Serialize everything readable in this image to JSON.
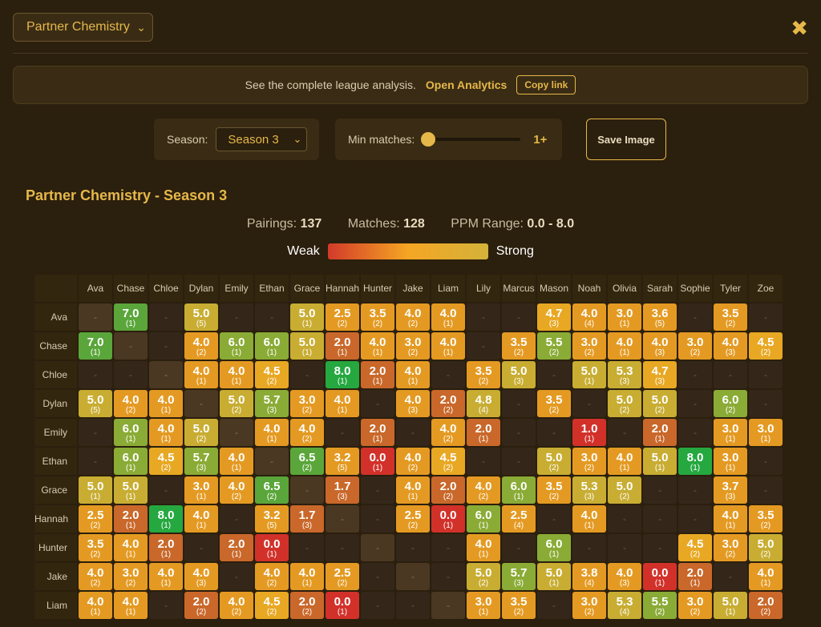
{
  "header": {
    "mode_label": "Partner Chemistry",
    "close_glyph": "✖"
  },
  "banner": {
    "text": "See the complete league analysis.",
    "link": "Open Analytics",
    "copy": "Copy link"
  },
  "controls": {
    "season_label": "Season:",
    "season_value": "Season 3",
    "min_label": "Min matches:",
    "min_value": "1+",
    "min_level_fraction": 0,
    "save_label": "Save Image"
  },
  "title": "Partner Chemistry - Season 3",
  "stats": {
    "pairings_label": "Pairings:",
    "pairings_value": "137",
    "matches_label": "Matches:",
    "matches_value": "128",
    "range_label": "PPM Range:",
    "range_value": "0.0 - 8.0"
  },
  "legend": {
    "weak": "Weak",
    "strong": "Strong"
  },
  "colors": {
    "accent": "#e6b84a",
    "background": "#2b1f0d",
    "panel": "#3a2c14"
  },
  "matrix": {
    "columns": [
      "Ava",
      "Chase",
      "Chloe",
      "Dylan",
      "Emily",
      "Ethan",
      "Grace",
      "Hannah",
      "Hunter",
      "Jake",
      "Liam",
      "Lily",
      "Marcus",
      "Mason",
      "Noah",
      "Olivia",
      "Sarah",
      "Sophie",
      "Tyler",
      "Zoe"
    ],
    "rows": [
      {
        "name": "Ava",
        "cells": [
          "-",
          "7.0|1",
          "-",
          "5.0|5",
          "-",
          "-",
          "5.0|1",
          "2.5|2",
          "3.5|2",
          "4.0|2",
          "4.0|1",
          "-",
          "-",
          "4.7|3",
          "4.0|4",
          "3.0|1",
          "3.6|5",
          "-",
          "3.5|2",
          "-"
        ]
      },
      {
        "name": "Chase",
        "cells": [
          "7.0|1",
          "-",
          "-",
          "4.0|2",
          "6.0|1",
          "6.0|1",
          "5.0|1",
          "2.0|1",
          "4.0|1",
          "3.0|2",
          "4.0|1",
          "-",
          "3.5|2",
          "5.5|2",
          "3.0|2",
          "4.0|1",
          "4.0|3",
          "3.0|2",
          "4.0|3",
          "4.5|2"
        ]
      },
      {
        "name": "Chloe",
        "cells": [
          "-",
          "-",
          "-",
          "4.0|1",
          "4.0|1",
          "4.5|2",
          "-",
          "8.0|1",
          "2.0|1",
          "4.0|1",
          "-",
          "3.5|2",
          "5.0|3",
          "-",
          "5.0|1",
          "5.3|3",
          "4.7|3",
          "-",
          "-",
          "-"
        ]
      },
      {
        "name": "Dylan",
        "cells": [
          "5.0|5",
          "4.0|2",
          "4.0|1",
          "-",
          "5.0|2",
          "5.7|3",
          "3.0|2",
          "4.0|1",
          "-",
          "4.0|3",
          "2.0|2",
          "4.8|4",
          "-",
          "3.5|2",
          "-",
          "5.0|2",
          "5.0|2",
          "-",
          "6.0|2",
          "-"
        ]
      },
      {
        "name": "Emily",
        "cells": [
          "-",
          "6.0|1",
          "4.0|1",
          "5.0|2",
          "-",
          "4.0|1",
          "4.0|2",
          "-",
          "2.0|1",
          "-",
          "4.0|2",
          "2.0|1",
          "-",
          "-",
          "1.0|1",
          "-",
          "2.0|1",
          "-",
          "3.0|1",
          "3.0|1"
        ]
      },
      {
        "name": "Ethan",
        "cells": [
          "-",
          "6.0|1",
          "4.5|2",
          "5.7|3",
          "4.0|1",
          "-",
          "6.5|2",
          "3.2|5",
          "0.0|1",
          "4.0|2",
          "4.5|2",
          "-",
          "-",
          "5.0|2",
          "3.0|2",
          "4.0|1",
          "5.0|1",
          "8.0|1",
          "3.0|1",
          "-"
        ]
      },
      {
        "name": "Grace",
        "cells": [
          "5.0|1",
          "5.0|1",
          "-",
          "3.0|1",
          "4.0|2",
          "6.5|2",
          "-",
          "1.7|3",
          "-",
          "4.0|1",
          "2.0|2",
          "4.0|2",
          "6.0|1",
          "3.5|2",
          "5.3|3",
          "5.0|2",
          "-",
          "-",
          "3.7|3",
          "-"
        ]
      },
      {
        "name": "Hannah",
        "cells": [
          "2.5|2",
          "2.0|1",
          "8.0|1",
          "4.0|1",
          "-",
          "3.2|5",
          "1.7|3",
          "-",
          "-",
          "2.5|2",
          "0.0|1",
          "6.0|1",
          "2.5|4",
          "-",
          "4.0|1",
          "-",
          "-",
          "-",
          "4.0|1",
          "3.5|2"
        ]
      },
      {
        "name": "Hunter",
        "cells": [
          "3.5|2",
          "4.0|1",
          "2.0|1",
          "-",
          "2.0|1",
          "0.0|1",
          "-",
          "-",
          "-",
          "-",
          "-",
          "4.0|1",
          "-",
          "6.0|1",
          "-",
          "-",
          "-",
          "4.5|2",
          "3.0|2",
          "5.0|2"
        ]
      },
      {
        "name": "Jake",
        "cells": [
          "4.0|2",
          "3.0|2",
          "4.0|1",
          "4.0|3",
          "-",
          "4.0|2",
          "4.0|1",
          "2.5|2",
          "-",
          "-",
          "-",
          "5.0|2",
          "5.7|3",
          "5.0|1",
          "3.8|4",
          "4.0|3",
          "0.0|1",
          "2.0|1",
          "-",
          "4.0|1"
        ]
      },
      {
        "name": "Liam",
        "cells": [
          "4.0|1",
          "4.0|1",
          "-",
          "2.0|2",
          "4.0|2",
          "4.5|2",
          "2.0|2",
          "0.0|1",
          "-",
          "-",
          "-",
          "3.0|1",
          "3.5|2",
          "-",
          "3.0|2",
          "5.3|4",
          "5.5|2",
          "3.0|2",
          "5.0|1",
          "2.0|2"
        ]
      }
    ]
  }
}
